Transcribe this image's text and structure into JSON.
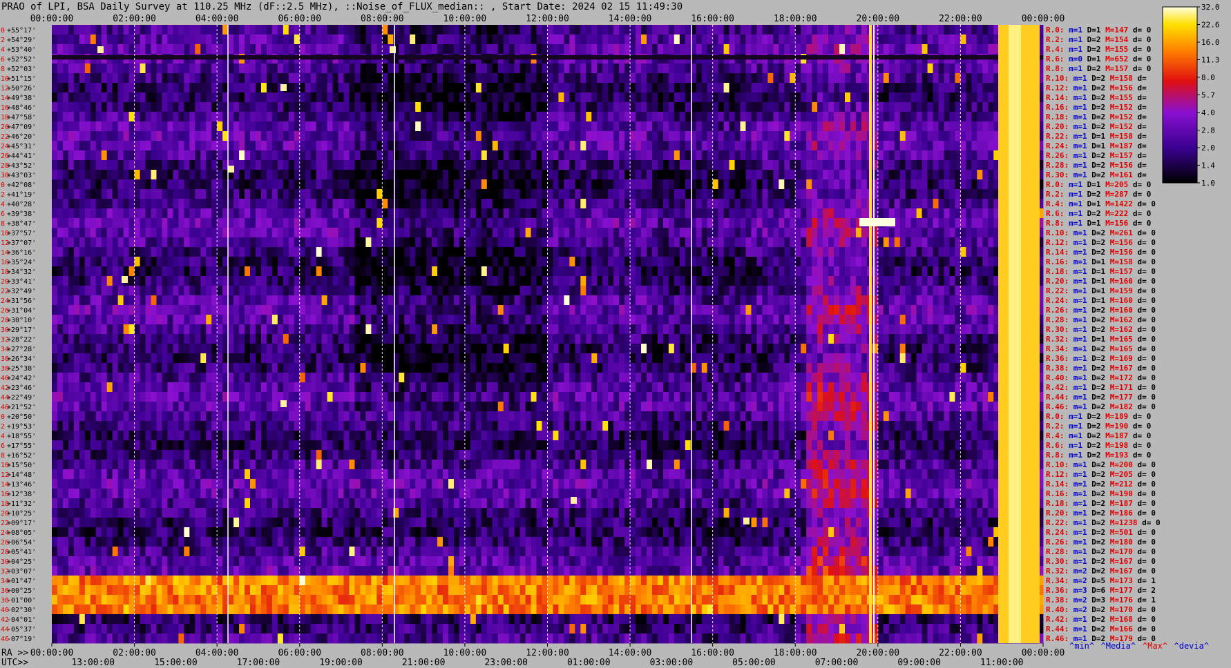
{
  "title": "PRAO of LPI, BSA Daily Survey at 110.25 MHz (dF::2.5 MHz), ::Noise_of_FLUX_median:: , Start Date: 2024 02 15 11:49:30",
  "colors": {
    "background": "#b9b9b9",
    "label_red": "#e00000",
    "label_blue": "#0000d0"
  },
  "chart_data": {
    "type": "heatmap",
    "colormap": "gnuplot-like: black → purple → red → orange → yellow → white",
    "top_axis": {
      "label": "",
      "ticks": [
        "00:00:00",
        "02:00:00",
        "04:00:00",
        "06:00:00",
        "08:00:00",
        "10:00:00",
        "12:00:00",
        "14:00:00",
        "16:00:00",
        "18:00:00",
        "20:00:00",
        "22:00:00",
        "00:00:00"
      ]
    },
    "bottom_axis_ra": {
      "label": "RA >>",
      "ticks": [
        "00:00:00",
        "02:00:00",
        "04:00:00",
        "06:00:00",
        "08:00:00",
        "10:00:00",
        "12:00:00",
        "14:00:00",
        "16:00:00",
        "18:00:00",
        "20:00:00",
        "22:00:00",
        "00:00:00"
      ]
    },
    "bottom_axis_utc": {
      "label": "UTC>>",
      "ticks": [
        "13:00:00",
        "15:00:00",
        "17:00:00",
        "19:00:00",
        "21:00:00",
        "23:00:00",
        "01:00:00",
        "03:00:00",
        "05:00:00",
        "07:00:00",
        "09:00:00",
        "11:00:00"
      ]
    },
    "declinations": [
      "+55°17'",
      "+54°29'",
      "+53°40'",
      "+52°52'",
      "+52°03'",
      "+51°15'",
      "+50°26'",
      "+49°38'",
      "+48°46'",
      "+47°58'",
      "+47°09'",
      "+46°20'",
      "+45°31'",
      "+44°41'",
      "+43°52'",
      "+43°03'",
      "+42°08'",
      "+41°19'",
      "+40°28'",
      "+39°38'",
      "+38°47'",
      "+37°57'",
      "+37°07'",
      "+36°16'",
      "+35°24'",
      "+34°32'",
      "+33°41'",
      "+32°49'",
      "+31°56'",
      "+31°04'",
      "+30°10'",
      "+29°17'",
      "+28°22'",
      "+27°28'",
      "+26°34'",
      "+25°38'",
      "+24°42'",
      "+23°46'",
      "+22°49'",
      "+21°52'",
      "+20°50'",
      "+19°53'",
      "+18°55'",
      "+17°55'",
      "+16°52'",
      "+15°50'",
      "+14°48'",
      "+13°46'",
      "+12°38'",
      "+11°32'",
      "+10°25'",
      "+09°17'",
      "+08°05'",
      "+06°54'",
      "+05°41'",
      "+04°25'",
      "+03°07'",
      "+01°47'",
      "+00°25'",
      "-01°00'",
      "-02°30'",
      "-04°01'",
      "-05°37'",
      "-07°19'"
    ],
    "row_indices": [
      "0",
      "2",
      "4",
      "6",
      "8",
      "10",
      "12",
      "14",
      "16",
      "18",
      "20",
      "22",
      "24",
      "26",
      "28",
      "30",
      "0",
      "2",
      "4",
      "6",
      "8",
      "10",
      "12",
      "14",
      "16",
      "18",
      "20",
      "22",
      "24",
      "26",
      "28",
      "30",
      "32",
      "34",
      "36",
      "38",
      "40",
      "42",
      "44",
      "46",
      "0",
      "2",
      "4",
      "6",
      "8",
      "10",
      "12",
      "14",
      "16",
      "18",
      "20",
      "22",
      "24",
      "26",
      "28",
      "30",
      "32",
      "34",
      "36",
      "38",
      "40",
      "42",
      "44",
      "46"
    ],
    "beam_stats": [
      {
        "r": "R.0:",
        "m": "m=1",
        "D": "D=1",
        "M": "M=147",
        "d": "d= 0"
      },
      {
        "r": "R.2:",
        "m": "m=1",
        "D": "D=2",
        "M": "M=154",
        "d": "d= 0"
      },
      {
        "r": "R.4:",
        "m": "m=1",
        "D": "D=2",
        "M": "M=155",
        "d": "d= 0"
      },
      {
        "r": "R.6:",
        "m": "m=0",
        "D": "D=1",
        "M": "M=652",
        "d": "d= 0"
      },
      {
        "r": "R.8:",
        "m": "m=1",
        "D": "D=2",
        "M": "M=157",
        "d": "d= 0"
      },
      {
        "r": "R.10:",
        "m": "m=1",
        "D": "D=2",
        "M": "M=158",
        "d": "d="
      },
      {
        "r": "R.12:",
        "m": "m=1",
        "D": "D=2",
        "M": "M=156",
        "d": "d="
      },
      {
        "r": "R.14:",
        "m": "m=1",
        "D": "D=2",
        "M": "M=155",
        "d": "d="
      },
      {
        "r": "R.16:",
        "m": "m=1",
        "D": "D=2",
        "M": "M=152",
        "d": "d="
      },
      {
        "r": "R.18:",
        "m": "m=1",
        "D": "D=2",
        "M": "M=152",
        "d": "d="
      },
      {
        "r": "R.20:",
        "m": "m=1",
        "D": "D=2",
        "M": "M=152",
        "d": "d="
      },
      {
        "r": "R.22:",
        "m": "m=1",
        "D": "D=1",
        "M": "M=158",
        "d": "d="
      },
      {
        "r": "R.24:",
        "m": "m=1",
        "D": "D=1",
        "M": "M=187",
        "d": "d="
      },
      {
        "r": "R.26:",
        "m": "m=1",
        "D": "D=2",
        "M": "M=157",
        "d": "d="
      },
      {
        "r": "R.28:",
        "m": "m=1",
        "D": "D=2",
        "M": "M=156",
        "d": "d="
      },
      {
        "r": "R.30:",
        "m": "m=1",
        "D": "D=2",
        "M": "M=161",
        "d": "d="
      },
      {
        "r": "R.0:",
        "m": "m=1",
        "D": "D=1",
        "M": "M=205",
        "d": "d= 0"
      },
      {
        "r": "R.2:",
        "m": "m=1",
        "D": "D=2",
        "M": "M=287",
        "d": "d= 0"
      },
      {
        "r": "R.4:",
        "m": "m=1",
        "D": "D=1",
        "M": "M=1422",
        "d": "d= 0"
      },
      {
        "r": "R.6:",
        "m": "m=1",
        "D": "D=2",
        "M": "M=222",
        "d": "d= 0"
      },
      {
        "r": "R.8:",
        "m": "m=1",
        "D": "D=1",
        "M": "M=156",
        "d": "d= 0"
      },
      {
        "r": "R.10:",
        "m": "m=1",
        "D": "D=2",
        "M": "M=261",
        "d": "d= 0"
      },
      {
        "r": "R.12:",
        "m": "m=1",
        "D": "D=2",
        "M": "M=156",
        "d": "d= 0"
      },
      {
        "r": "R.14:",
        "m": "m=1",
        "D": "D=2",
        "M": "M=156",
        "d": "d= 0"
      },
      {
        "r": "R.16:",
        "m": "m=1",
        "D": "D=1",
        "M": "M=158",
        "d": "d= 0"
      },
      {
        "r": "R.18:",
        "m": "m=1",
        "D": "D=1",
        "M": "M=157",
        "d": "d= 0"
      },
      {
        "r": "R.20:",
        "m": "m=1",
        "D": "D=1",
        "M": "M=160",
        "d": "d= 0"
      },
      {
        "r": "R.22:",
        "m": "m=1",
        "D": "D=1",
        "M": "M=159",
        "d": "d= 0"
      },
      {
        "r": "R.24:",
        "m": "m=1",
        "D": "D=1",
        "M": "M=160",
        "d": "d= 0"
      },
      {
        "r": "R.26:",
        "m": "m=1",
        "D": "D=2",
        "M": "M=160",
        "d": "d= 0"
      },
      {
        "r": "R.28:",
        "m": "m=1",
        "D": "D=2",
        "M": "M=162",
        "d": "d= 0"
      },
      {
        "r": "R.30:",
        "m": "m=1",
        "D": "D=2",
        "M": "M=162",
        "d": "d= 0"
      },
      {
        "r": "R.32:",
        "m": "m=1",
        "D": "D=1",
        "M": "M=165",
        "d": "d= 0"
      },
      {
        "r": "R.34:",
        "m": "m=1",
        "D": "D=2",
        "M": "M=165",
        "d": "d= 0"
      },
      {
        "r": "R.36:",
        "m": "m=1",
        "D": "D=2",
        "M": "M=169",
        "d": "d= 0"
      },
      {
        "r": "R.38:",
        "m": "m=1",
        "D": "D=2",
        "M": "M=167",
        "d": "d= 0"
      },
      {
        "r": "R.40:",
        "m": "m=1",
        "D": "D=2",
        "M": "M=172",
        "d": "d= 0"
      },
      {
        "r": "R.42:",
        "m": "m=1",
        "D": "D=2",
        "M": "M=171",
        "d": "d= 0"
      },
      {
        "r": "R.44:",
        "m": "m=1",
        "D": "D=2",
        "M": "M=177",
        "d": "d= 0"
      },
      {
        "r": "R.46:",
        "m": "m=1",
        "D": "D=2",
        "M": "M=182",
        "d": "d= 0"
      },
      {
        "r": "R.0:",
        "m": "m=1",
        "D": "D=2",
        "M": "M=189",
        "d": "d= 0"
      },
      {
        "r": "R.2:",
        "m": "m=1",
        "D": "D=2",
        "M": "M=190",
        "d": "d= 0"
      },
      {
        "r": "R.4:",
        "m": "m=1",
        "D": "D=2",
        "M": "M=187",
        "d": "d= 0"
      },
      {
        "r": "R.6:",
        "m": "m=1",
        "D": "D=2",
        "M": "M=198",
        "d": "d= 0"
      },
      {
        "r": "R.8:",
        "m": "m=1",
        "D": "D=2",
        "M": "M=193",
        "d": "d= 0"
      },
      {
        "r": "R.10:",
        "m": "m=1",
        "D": "D=2",
        "M": "M=200",
        "d": "d= 0"
      },
      {
        "r": "R.12:",
        "m": "m=1",
        "D": "D=2",
        "M": "M=205",
        "d": "d= 0"
      },
      {
        "r": "R.14:",
        "m": "m=1",
        "D": "D=2",
        "M": "M=212",
        "d": "d= 0"
      },
      {
        "r": "R.16:",
        "m": "m=1",
        "D": "D=2",
        "M": "M=190",
        "d": "d= 0"
      },
      {
        "r": "R.18:",
        "m": "m=1",
        "D": "D=2",
        "M": "M=187",
        "d": "d= 0"
      },
      {
        "r": "R.20:",
        "m": "m=1",
        "D": "D=2",
        "M": "M=186",
        "d": "d= 0"
      },
      {
        "r": "R.22:",
        "m": "m=1",
        "D": "D=2",
        "M": "M=1238",
        "d": "d= 0"
      },
      {
        "r": "R.24:",
        "m": "m=1",
        "D": "D=2",
        "M": "M=501",
        "d": "d= 0"
      },
      {
        "r": "R.26:",
        "m": "m=1",
        "D": "D=2",
        "M": "M=180",
        "d": "d= 0"
      },
      {
        "r": "R.28:",
        "m": "m=1",
        "D": "D=2",
        "M": "M=170",
        "d": "d= 0"
      },
      {
        "r": "R.30:",
        "m": "m=1",
        "D": "D=2",
        "M": "M=167",
        "d": "d= 0"
      },
      {
        "r": "R.32:",
        "m": "m=2",
        "D": "D=2",
        "M": "M=167",
        "d": "d= 0"
      },
      {
        "r": "R.34:",
        "m": "m=2",
        "D": "D=5",
        "M": "M=173",
        "d": "d= 1"
      },
      {
        "r": "R.36:",
        "m": "m=3",
        "D": "D=6",
        "M": "M=177",
        "d": "d= 2"
      },
      {
        "r": "R.38:",
        "m": "m=2",
        "D": "D=3",
        "M": "M=176",
        "d": "d= 1"
      },
      {
        "r": "R.40:",
        "m": "m=2",
        "D": "D=2",
        "M": "M=170",
        "d": "d= 0"
      },
      {
        "r": "R.42:",
        "m": "m=1",
        "D": "D=2",
        "M": "M=168",
        "d": "d= 0"
      },
      {
        "r": "R.44:",
        "m": "m=1",
        "D": "D=2",
        "M": "M=166",
        "d": "d= 0"
      },
      {
        "r": "R.46:",
        "m": "m=1",
        "D": "D=2",
        "M": "M=179",
        "d": "d= 0"
      }
    ],
    "colorbar": {
      "labels": [
        "32.0",
        "22.6",
        "16.0",
        "11.3",
        "8.0",
        "5.7",
        "4.0",
        "2.8",
        "2.0",
        "1.4",
        "1.0"
      ],
      "range": [
        1.0,
        32.0
      ],
      "scale": "log2"
    },
    "legend_bottom": [
      {
        "text": "^min^",
        "color": "#0000d0"
      },
      {
        "text": "^Media^",
        "color": "#0000d0"
      },
      {
        "text": "^Max^",
        "color": "#e00000"
      },
      {
        "text": "^devia^",
        "color": "#0000d0"
      }
    ]
  }
}
